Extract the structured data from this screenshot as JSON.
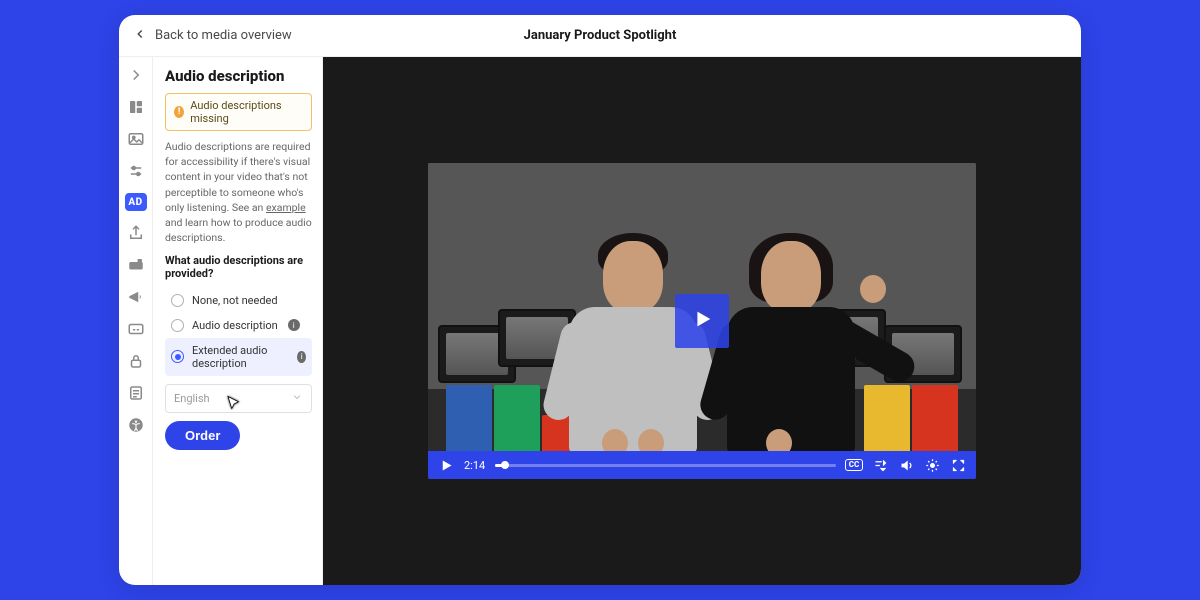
{
  "header": {
    "back_label": "Back to media overview",
    "title": "January Product Spotlight"
  },
  "rail": {
    "items": [
      {
        "name": "collapse",
        "glyph": "chevron"
      },
      {
        "name": "customize",
        "glyph": "palette"
      },
      {
        "name": "thumbnail",
        "glyph": "image"
      },
      {
        "name": "controls",
        "glyph": "sliders"
      },
      {
        "name": "ad",
        "glyph": "ad",
        "active": true,
        "label": "AD"
      },
      {
        "name": "share",
        "glyph": "share"
      },
      {
        "name": "cta",
        "glyph": "cta"
      },
      {
        "name": "broadcast",
        "glyph": "megaphone"
      },
      {
        "name": "captions",
        "glyph": "cc"
      },
      {
        "name": "privacy",
        "glyph": "lock"
      },
      {
        "name": "form",
        "glyph": "form"
      },
      {
        "name": "a11y",
        "glyph": "a11y"
      }
    ]
  },
  "panel": {
    "heading": "Audio description",
    "warning": "Audio descriptions missing",
    "help_pre": "Audio descriptions are required for accessibility if there's visual content in your video that's not perceptible to someone who's only listening. See an ",
    "help_link": "example",
    "help_post": " and learn how to produce audio descriptions.",
    "question": "What audio descriptions are provided?",
    "options": [
      {
        "label": "None, not needed",
        "info": false
      },
      {
        "label": "Audio description",
        "info": true
      },
      {
        "label": "Extended audio description",
        "info": true,
        "selected": true
      }
    ],
    "language_value": "English",
    "order_label": "Order"
  },
  "player": {
    "time": "2:14",
    "cc_label": "CC"
  }
}
